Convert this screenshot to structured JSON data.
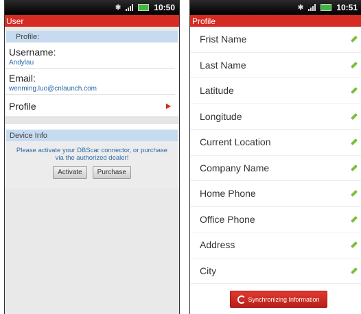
{
  "status_left": {
    "time": "10:50"
  },
  "status_right": {
    "time": "10:51"
  },
  "left_screen": {
    "title": "User",
    "profile_section": {
      "header": "Profile:",
      "username_label": "Username:",
      "username_value": "Andylau",
      "email_label": "Email:",
      "email_value": "wenming.luo@cnlaunch.com",
      "profile_link": "Profile"
    },
    "device_section": {
      "header": "Device Info",
      "message": "Please activate your DBScar connector, or purchase via the authorized dealer!",
      "activate_label": "Activate",
      "purchase_label": "Purchase"
    }
  },
  "right_screen": {
    "title": "Profile",
    "fields": [
      "Frist Name",
      "Last Name",
      "Latitude",
      "Longitude",
      "Current Location",
      "Company Name",
      "Home Phone",
      "Office Phone",
      "Address",
      "City"
    ],
    "sync_label": "Synchronizing Information"
  },
  "colors": {
    "accent": "#d62b22",
    "section_header": "#c6dbef",
    "link_text": "#2b6aaa",
    "edit_icon": "#7bbf3a"
  }
}
